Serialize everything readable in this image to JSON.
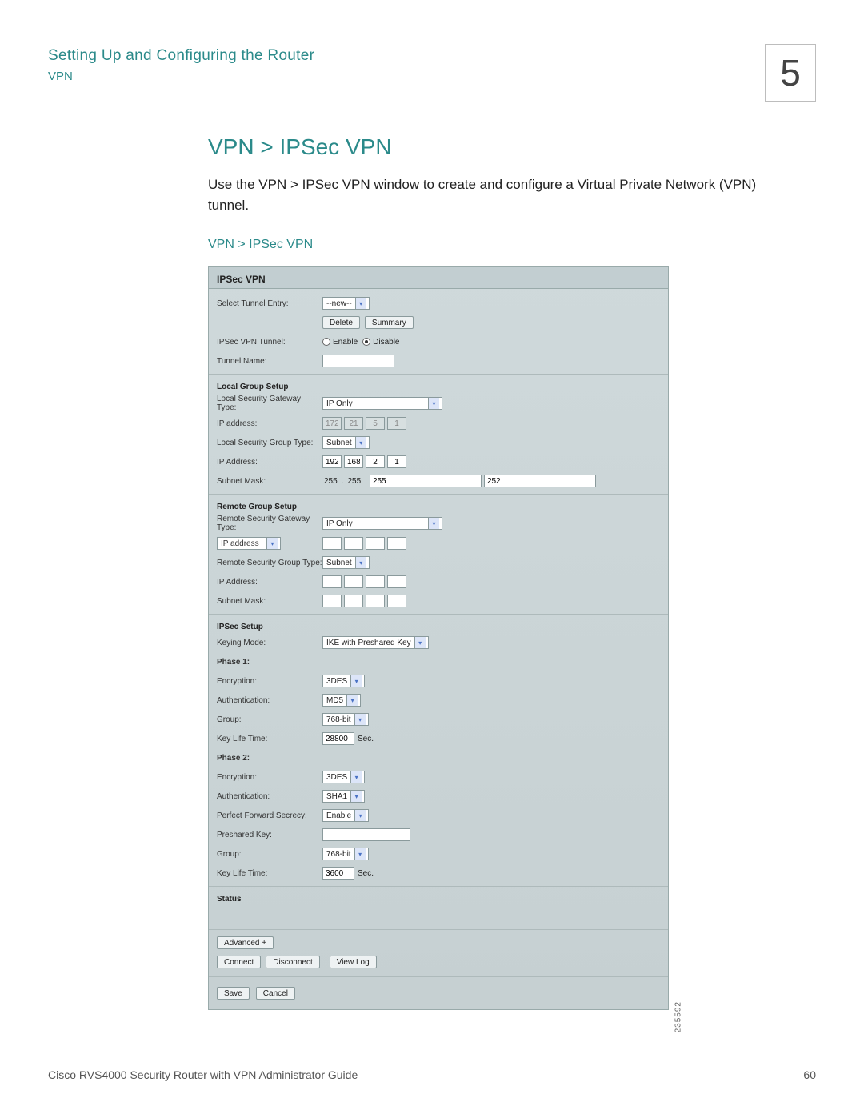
{
  "header": {
    "title": "Setting Up and Configuring the Router",
    "section": "VPN",
    "chapter": "5"
  },
  "page": {
    "heading": "VPN > IPSec VPN",
    "intro": "Use the VPN > IPSec VPN window to create and configure a Virtual Private Network (VPN) tunnel.",
    "caption": "VPN > IPSec VPN"
  },
  "panel": {
    "title": "IPSec VPN",
    "top": {
      "tunnel_entry_label": "Select Tunnel Entry:",
      "tunnel_entry_value": "--new--",
      "delete_btn": "Delete",
      "summary_btn": "Summary",
      "ipsec_tunnel_label": "IPSec VPN Tunnel:",
      "enable": "Enable",
      "disable": "Disable",
      "tunnel_name_label": "Tunnel Name:",
      "tunnel_name_value": ""
    },
    "local": {
      "heading": "Local Group Setup",
      "gw_type_label": "Local Security Gateway Type:",
      "gw_type_value": "IP Only",
      "ip_addr_label": "IP address:",
      "ip_addr": [
        "172",
        "21",
        "5",
        "1"
      ],
      "group_type_label": "Local Security Group Type:",
      "group_type_value": "Subnet",
      "ip2_label": "IP Address:",
      "ip2": [
        "192",
        "168",
        "2",
        "1"
      ],
      "mask_label": "Subnet Mask:",
      "mask": [
        "255",
        "255",
        "255",
        "252"
      ]
    },
    "remote": {
      "heading": "Remote Group Setup",
      "gw_type_label": "Remote Security Gateway Type:",
      "gw_type_value": "IP Only",
      "addr_mode_value": "IP address",
      "addr": [
        "",
        "",
        "",
        ""
      ],
      "group_type_label": "Remote Security Group Type:",
      "group_type_value": "Subnet",
      "ip2_label": "IP Address:",
      "ip2": [
        "",
        "",
        "",
        ""
      ],
      "mask_label": "Subnet Mask:",
      "mask": [
        "",
        "",
        "",
        ""
      ]
    },
    "ipsec": {
      "heading": "IPSec Setup",
      "keying_label": "Keying Mode:",
      "keying_value": "IKE with Preshared Key",
      "phase1": "Phase 1:",
      "p1_enc_label": "Encryption:",
      "p1_enc": "3DES",
      "p1_auth_label": "Authentication:",
      "p1_auth": "MD5",
      "p1_group_label": "Group:",
      "p1_group": "768-bit",
      "p1_life_label": "Key Life Time:",
      "p1_life": "28800",
      "sec": "Sec.",
      "phase2": "Phase 2:",
      "p2_enc_label": "Encryption:",
      "p2_enc": "3DES",
      "p2_auth_label": "Authentication:",
      "p2_auth": "SHA1",
      "pfs_label": "Perfect Forward Secrecy:",
      "pfs": "Enable",
      "psk_label": "Preshared Key:",
      "psk": "",
      "p2_group_label": "Group:",
      "p2_group": "768-bit",
      "p2_life_label": "Key Life Time:",
      "p2_life": "3600"
    },
    "status_heading": "Status",
    "buttons": {
      "advanced": "Advanced +",
      "connect": "Connect",
      "disconnect": "Disconnect",
      "viewlog": "View Log",
      "save": "Save",
      "cancel": "Cancel"
    },
    "image_id": "235592"
  },
  "footer": {
    "guide": "Cisco RVS4000 Security Router with VPN Administrator Guide",
    "page": "60"
  }
}
